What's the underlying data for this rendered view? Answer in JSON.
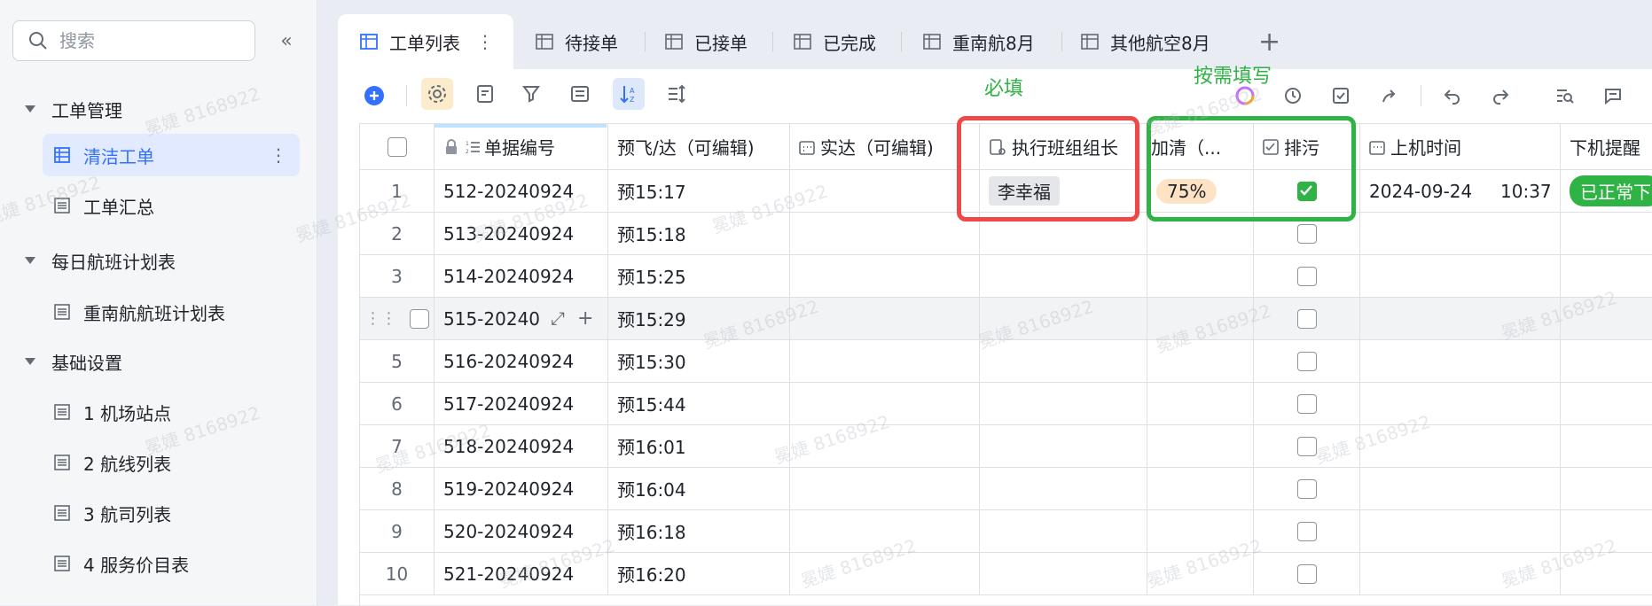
{
  "sidebar": {
    "search_placeholder": "搜索",
    "groups": [
      {
        "label": "工单管理"
      },
      {
        "label": "每日航班计划表"
      },
      {
        "label": "基础设置"
      }
    ],
    "leaves": [
      {
        "label": "清洁工单"
      },
      {
        "label": "工单汇总"
      },
      {
        "label": "重南航航班计划表"
      },
      {
        "label": "1 机场站点"
      },
      {
        "label": "2 航线列表"
      },
      {
        "label": "3 航司列表"
      },
      {
        "label": "4 服务价目表"
      }
    ]
  },
  "tabs": [
    {
      "label": "工单列表"
    },
    {
      "label": "待接单"
    },
    {
      "label": "已接单"
    },
    {
      "label": "已完成"
    },
    {
      "label": "重南航8月"
    },
    {
      "label": "其他航空8月"
    }
  ],
  "annotations": {
    "required": "必填",
    "optional": "按需填写"
  },
  "columns": [
    {
      "label": "单据编号"
    },
    {
      "label": "预飞/达（可编辑)"
    },
    {
      "label": "实达（可编辑)"
    },
    {
      "label": "执行班组组长"
    },
    {
      "label": "加清（..."
    },
    {
      "label": "排污"
    },
    {
      "label": "上机时间"
    },
    {
      "label": "下机提醒"
    }
  ],
  "rows": [
    {
      "num": "1",
      "id": "512-20240924",
      "eta": "预15:17",
      "leader": "李幸福",
      "extra": "75%",
      "checked": true,
      "on_time": "2024-09-24     10:37",
      "status": "已正常下"
    },
    {
      "num": "2",
      "id": "513-20240924",
      "eta": "预15:18",
      "leader": "",
      "extra": "",
      "checked": false,
      "on_time": "",
      "status": ""
    },
    {
      "num": "3",
      "id": "514-20240924",
      "eta": "预15:25",
      "leader": "",
      "extra": "",
      "checked": false,
      "on_time": "",
      "status": ""
    },
    {
      "num": "",
      "id": "515-20240",
      "eta": "预15:29",
      "leader": "",
      "extra": "",
      "checked": false,
      "on_time": "",
      "status": ""
    },
    {
      "num": "5",
      "id": "516-20240924",
      "eta": "预15:30",
      "leader": "",
      "extra": "",
      "checked": false,
      "on_time": "",
      "status": ""
    },
    {
      "num": "6",
      "id": "517-20240924",
      "eta": "预15:44",
      "leader": "",
      "extra": "",
      "checked": false,
      "on_time": "",
      "status": ""
    },
    {
      "num": "7",
      "id": "518-20240924",
      "eta": "预16:01",
      "leader": "",
      "extra": "",
      "checked": false,
      "on_time": "",
      "status": ""
    },
    {
      "num": "8",
      "id": "519-20240924",
      "eta": "预16:04",
      "leader": "",
      "extra": "",
      "checked": false,
      "on_time": "",
      "status": ""
    },
    {
      "num": "9",
      "id": "520-20240924",
      "eta": "预16:18",
      "leader": "",
      "extra": "",
      "checked": false,
      "on_time": "",
      "status": ""
    },
    {
      "num": "10",
      "id": "521-20240924",
      "eta": "预16:20",
      "leader": "",
      "extra": "",
      "checked": false,
      "on_time": "",
      "status": ""
    }
  ],
  "watermark_text": "冕婕 8168922",
  "colors": {
    "accent": "#3370ff",
    "red_box": "#f04848",
    "green_box": "#2fb344"
  }
}
